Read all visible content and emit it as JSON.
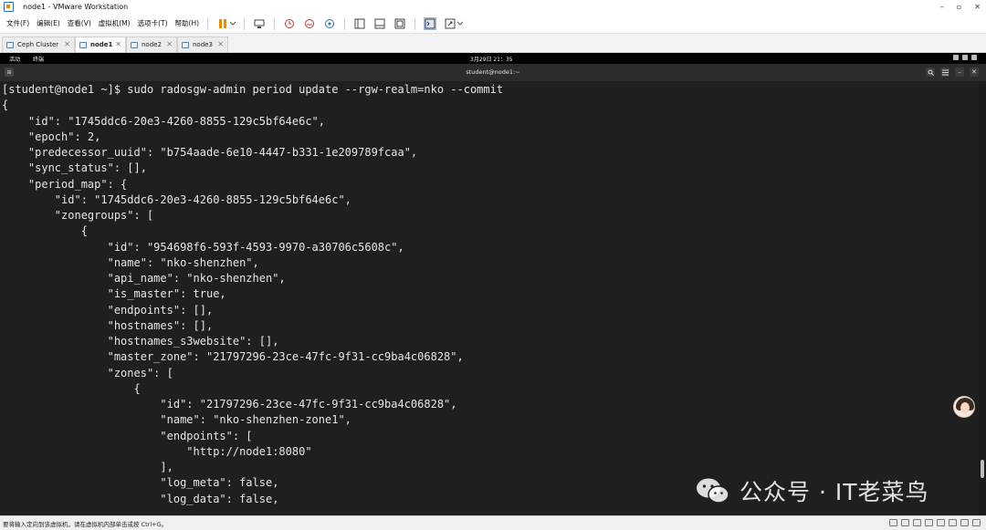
{
  "window": {
    "title": "node1 - VMware Workstation",
    "controls": [
      "–",
      "▫",
      "✕"
    ]
  },
  "menu": {
    "items": [
      "文件(F)",
      "编辑(E)",
      "查看(V)",
      "虚拟机(M)",
      "选项卡(T)",
      "帮助(H)"
    ]
  },
  "tabs": [
    {
      "label": "Ceph Cluster",
      "active": false
    },
    {
      "label": "node1",
      "active": true
    },
    {
      "label": "node2",
      "active": false
    },
    {
      "label": "node3",
      "active": false
    }
  ],
  "gnome": {
    "activities": "活动",
    "terminal_app": "终端",
    "clock": "3月29日 21：35"
  },
  "terminal": {
    "title": "student@node1:~",
    "lines": [
      "[student@node1 ~]$ sudo radosgw-admin period update --rgw-realm=nko --commit",
      "{",
      "    \"id\": \"1745ddc6-20e3-4260-8855-129c5bf64e6c\",",
      "    \"epoch\": 2,",
      "    \"predecessor_uuid\": \"b754aade-6e10-4447-b331-1e209789fcaa\",",
      "    \"sync_status\": [],",
      "    \"period_map\": {",
      "        \"id\": \"1745ddc6-20e3-4260-8855-129c5bf64e6c\",",
      "        \"zonegroups\": [",
      "            {",
      "                \"id\": \"954698f6-593f-4593-9970-a30706c5608c\",",
      "                \"name\": \"nko-shenzhen\",",
      "                \"api_name\": \"nko-shenzhen\",",
      "                \"is_master\": true,",
      "                \"endpoints\": [],",
      "                \"hostnames\": [],",
      "                \"hostnames_s3website\": [],",
      "                \"master_zone\": \"21797296-23ce-47fc-9f31-cc9ba4c06828\",",
      "                \"zones\": [",
      "                    {",
      "                        \"id\": \"21797296-23ce-47fc-9f31-cc9ba4c06828\",",
      "                        \"name\": \"nko-shenzhen-zone1\",",
      "                        \"endpoints\": [",
      "                            \"http://node1:8080\"",
      "                        ],",
      "                        \"log_meta\": false,",
      "                        \"log_data\": false,"
    ]
  },
  "watermark": {
    "text": "公众号 · IT老菜鸟"
  },
  "status": {
    "text": "要将输入定向到该虚拟机，请在虚拟机内部单击或按 Ctrl+G。"
  },
  "colors": {
    "terminal_bg": "#1f1f1f",
    "terminal_fg": "#e6e6e6",
    "header_bg": "#2c2c2c",
    "accent_orange": "#f08a00"
  }
}
